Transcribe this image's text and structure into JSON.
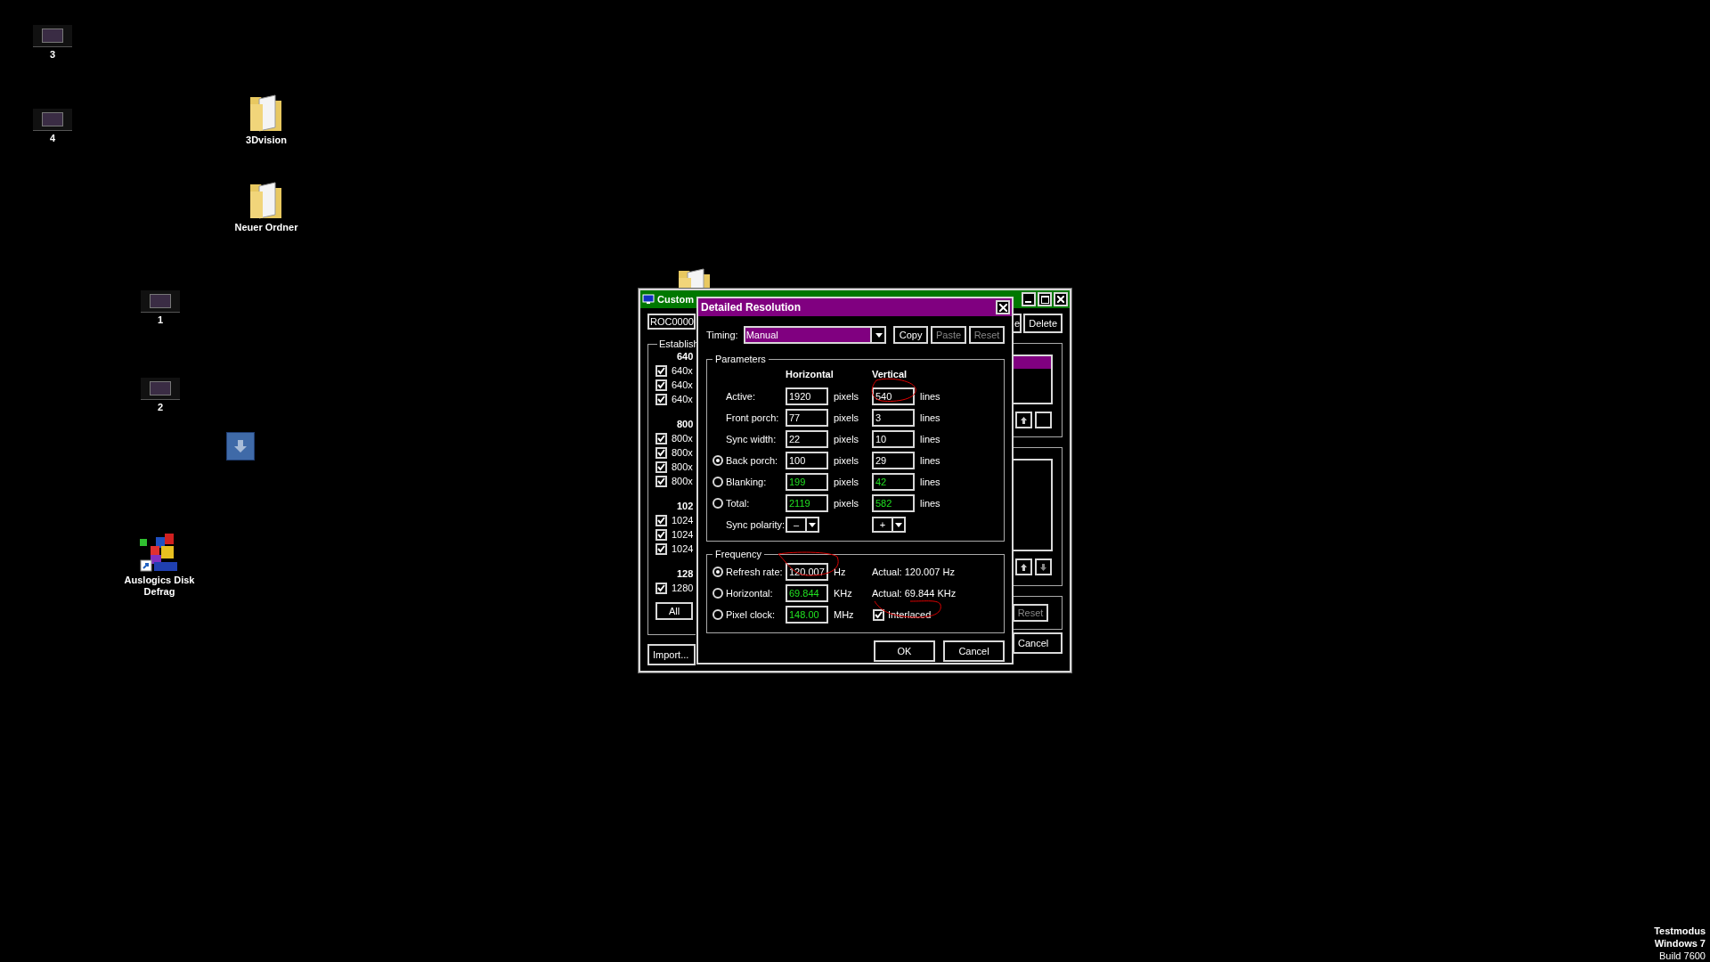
{
  "desktop_icons": [
    {
      "kind": "thumbnail",
      "label": "3"
    },
    {
      "kind": "thumbnail",
      "label": "4"
    },
    {
      "kind": "folder",
      "label": "3Dvision"
    },
    {
      "kind": "folder",
      "label": "Neuer Ordner"
    },
    {
      "kind": "thumbnail",
      "label": "1"
    },
    {
      "kind": "thumbnail",
      "label": "2"
    },
    {
      "kind": "download"
    },
    {
      "kind": "app",
      "label": "Auslogics Disk Defrag"
    },
    {
      "kind": "folder"
    }
  ],
  "back_window": {
    "title": "Custom",
    "device": "ROC0000",
    "group_title": "Establish",
    "sections": [
      {
        "header": "640",
        "modes": [
          {
            "label": "640x",
            "checked": true
          },
          {
            "label": "640x",
            "checked": true
          },
          {
            "label": "640x",
            "checked": true
          }
        ]
      },
      {
        "header": "800",
        "modes": [
          {
            "label": "800x",
            "checked": true
          },
          {
            "label": "800x",
            "checked": true
          },
          {
            "label": "800x",
            "checked": true
          },
          {
            "label": "800x",
            "checked": true
          }
        ]
      },
      {
        "header": "102",
        "modes": [
          {
            "label": "1024",
            "checked": true
          },
          {
            "label": "1024",
            "checked": true
          },
          {
            "label": "1024",
            "checked": true
          }
        ]
      },
      {
        "header": "128",
        "modes": [
          {
            "label": "1280",
            "checked": true
          }
        ]
      }
    ],
    "all_button": "All",
    "import_button": "Import...",
    "top_buttons": [
      {
        "label": "e",
        "disabled": false
      },
      {
        "label": "Delete",
        "disabled": false
      }
    ],
    "reset_button": {
      "label": "Reset",
      "disabled": true
    },
    "cancel_button": "Cancel"
  },
  "dialog": {
    "title": "Detailed Resolution",
    "timing_label": "Timing:",
    "timing_value": "Manual",
    "buttons": [
      {
        "label": "Copy",
        "disabled": false
      },
      {
        "label": "Paste",
        "disabled": true
      },
      {
        "label": "Reset",
        "disabled": true
      }
    ],
    "parameters": {
      "title": "Parameters",
      "col_h": "Horizontal",
      "col_v": "Vertical",
      "rows": [
        {
          "kind": "plain",
          "label": "Active:",
          "h": "1920",
          "h_unit": "pixels",
          "v": "540",
          "v_unit": "lines",
          "computed": false
        },
        {
          "kind": "plain",
          "label": "Front porch:",
          "h": "77",
          "h_unit": "pixels",
          "v": "3",
          "v_unit": "lines",
          "computed": false
        },
        {
          "kind": "plain",
          "label": "Sync width:",
          "h": "22",
          "h_unit": "pixels",
          "v": "10",
          "v_unit": "lines",
          "computed": false
        },
        {
          "kind": "radio",
          "selected": true,
          "label": "Back porch:",
          "h": "100",
          "h_unit": "pixels",
          "v": "29",
          "v_unit": "lines",
          "computed": false
        },
        {
          "kind": "radio",
          "selected": false,
          "label": "Blanking:",
          "h": "199",
          "h_unit": "pixels",
          "v": "42",
          "v_unit": "lines",
          "computed": true
        },
        {
          "kind": "radio",
          "selected": false,
          "label": "Total:",
          "h": "2119",
          "h_unit": "pixels",
          "v": "582",
          "v_unit": "lines",
          "computed": true
        },
        {
          "kind": "polarity",
          "label": "Sync polarity:",
          "h": "–",
          "v": "+"
        }
      ]
    },
    "frequency": {
      "title": "Frequency",
      "rows": [
        {
          "label": "Refresh rate:",
          "selected": true,
          "value": "120.007",
          "computed": false,
          "unit": "Hz",
          "actual": "Actual: 120.007 Hz"
        },
        {
          "label": "Horizontal:",
          "selected": false,
          "value": "69.844",
          "computed": true,
          "unit": "KHz",
          "actual": "Actual: 69.844 KHz"
        },
        {
          "label": "Pixel clock:",
          "selected": false,
          "value": "148.00",
          "computed": true,
          "unit": "MHz"
        }
      ],
      "interlaced": {
        "label": "Interlaced",
        "checked": true
      }
    },
    "ok_button": "OK",
    "cancel_button": "Cancel"
  },
  "os_notice": [
    "Testmodus",
    "Windows 7",
    "Build 7600"
  ]
}
